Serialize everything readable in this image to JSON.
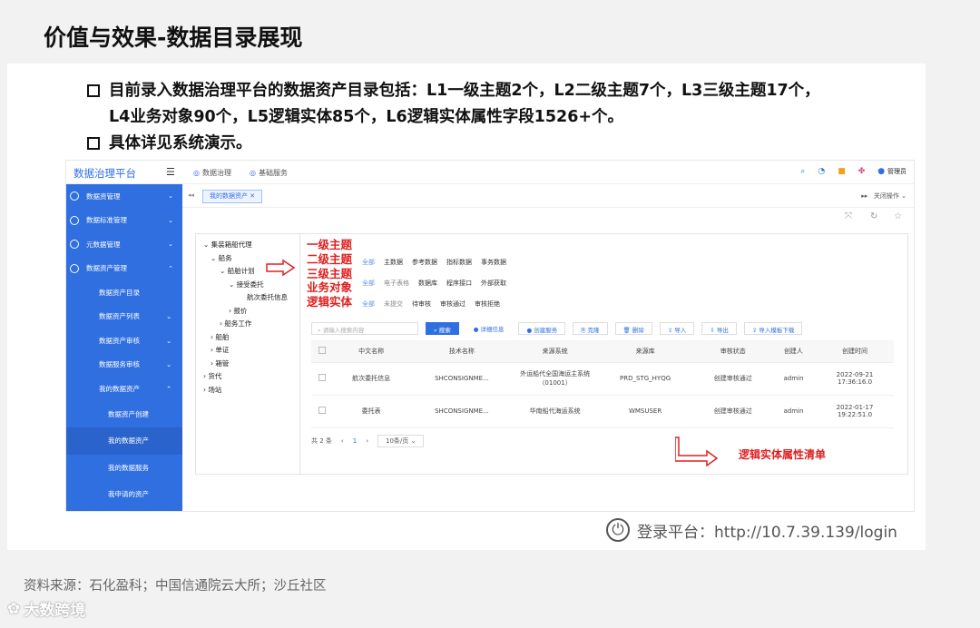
{
  "slide": {
    "title": "价值与效果-数据目录展现",
    "bullet1_line1": "目前录入数据治理平台的数据资产目录包括：L1一级主题2个，L2二级主题7个，L3三级主题17个，",
    "bullet1_line2": "L4业务对象90个，L5逻辑实体85个，L6逻辑实体属性字段1526+个。",
    "bullet2": "具体详见系统演示。",
    "login_text": "登录平台：http://10.7.39.139/login",
    "source": "资料来源：石化盈科；中国信通院云大所；沙丘社区",
    "watermark": "大数跨境"
  },
  "app": {
    "logo": "数据治理平台",
    "topnav": [
      "数据治理",
      "基础服务"
    ],
    "user": "管理员",
    "sidebar": [
      {
        "label": "数据资管理"
      },
      {
        "label": "数据标准管理"
      },
      {
        "label": "元数据管理"
      },
      {
        "label": "数据资产管理"
      }
    ],
    "sidebar_sub": [
      "数据资产目录",
      "数据资产列表",
      "数据资产审核",
      "数据服务审核",
      "我的数据资产"
    ],
    "sidebar_sub2": [
      "数据资产创建",
      "我的数据资产",
      "我的数据服务",
      "我申请的资产"
    ],
    "tab": "我的数据资产",
    "tab_right": "关闭操作",
    "tree": [
      "集装箱船代理",
      "船务",
      "船舶计划",
      "接受委托",
      "航次委托信息",
      "报价",
      "船务工作",
      "船舶",
      "单证",
      "箱管",
      "货代",
      "场站"
    ],
    "filters": {
      "row1": [
        "全部",
        "主数据",
        "参考数据",
        "指标数据",
        "事务数据"
      ],
      "row2": [
        "全部",
        "电子表格",
        "数据库",
        "程序接口",
        "外部获取"
      ],
      "row3": [
        "全部",
        "未提交",
        "待审核",
        "审核通过",
        "审核拒绝"
      ]
    },
    "search_placeholder": "请输入搜索内容",
    "buttons": [
      "搜索",
      "详细信息",
      "创建服务",
      "克隆",
      "删除",
      "导入",
      "导出",
      "导入模板下载"
    ],
    "columns": [
      "中文名称",
      "技术名称",
      "来源系统",
      "来源库",
      "审核状态",
      "创建人",
      "创建时间"
    ],
    "rows": [
      [
        "航次委托信息",
        "SHCONSIGNME...",
        "外运船代全国海运主系统（01001）",
        "PRD_STG_HYQG",
        "创建审核通过",
        "admin",
        "2022-09-21 17:36:16.0"
      ],
      [
        "委托表",
        "SHCONSIGNME...",
        "华南船代海运系统",
        "WMSUSER",
        "创建审核通过",
        "admin",
        "2022-01-17 19:22:51.0"
      ]
    ],
    "pager": {
      "total": "共 2 条",
      "page": "1",
      "size": "10条/页"
    }
  },
  "annotations": {
    "levels": [
      "一级主题",
      "二级主题",
      "三级主题",
      "业务对象",
      "逻辑实体"
    ],
    "attr": "逻辑实体属性清单",
    "color": "#e02020"
  }
}
